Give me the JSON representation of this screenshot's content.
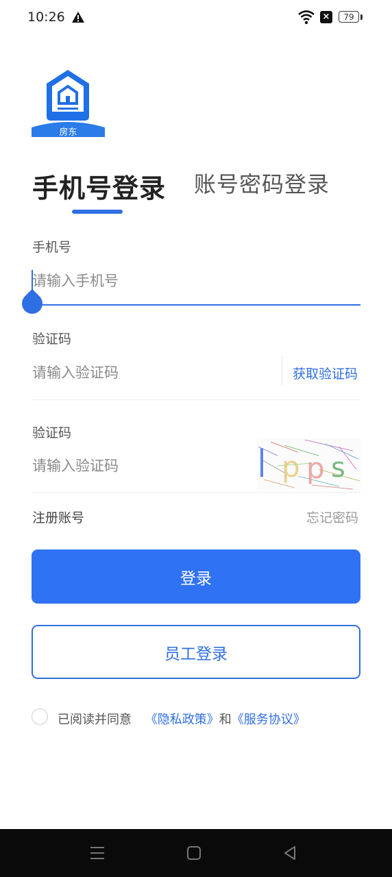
{
  "status": {
    "time": "10:26",
    "battery": "79"
  },
  "logo": {
    "text": "房东"
  },
  "tabs": {
    "active": "手机号登录",
    "inactive": "账号密码登录"
  },
  "phone": {
    "label": "手机号",
    "placeholder": "请输入手机号"
  },
  "sms_code": {
    "label": "验证码",
    "placeholder": "请输入验证码",
    "action": "获取验证码"
  },
  "captcha": {
    "label": "验证码",
    "placeholder": "请输入验证码",
    "image_text": "lpps"
  },
  "links": {
    "register": "注册账号",
    "forgot": "忘记密码"
  },
  "buttons": {
    "login": "登录",
    "staff_login": "员工登录"
  },
  "agreement": {
    "prefix": "已阅读并同意",
    "privacy": "《隐私政策》",
    "and": "和",
    "service": "《服务协议》"
  },
  "colors": {
    "accent": "#2f6fe4",
    "primary_button": "#2f72f3"
  }
}
